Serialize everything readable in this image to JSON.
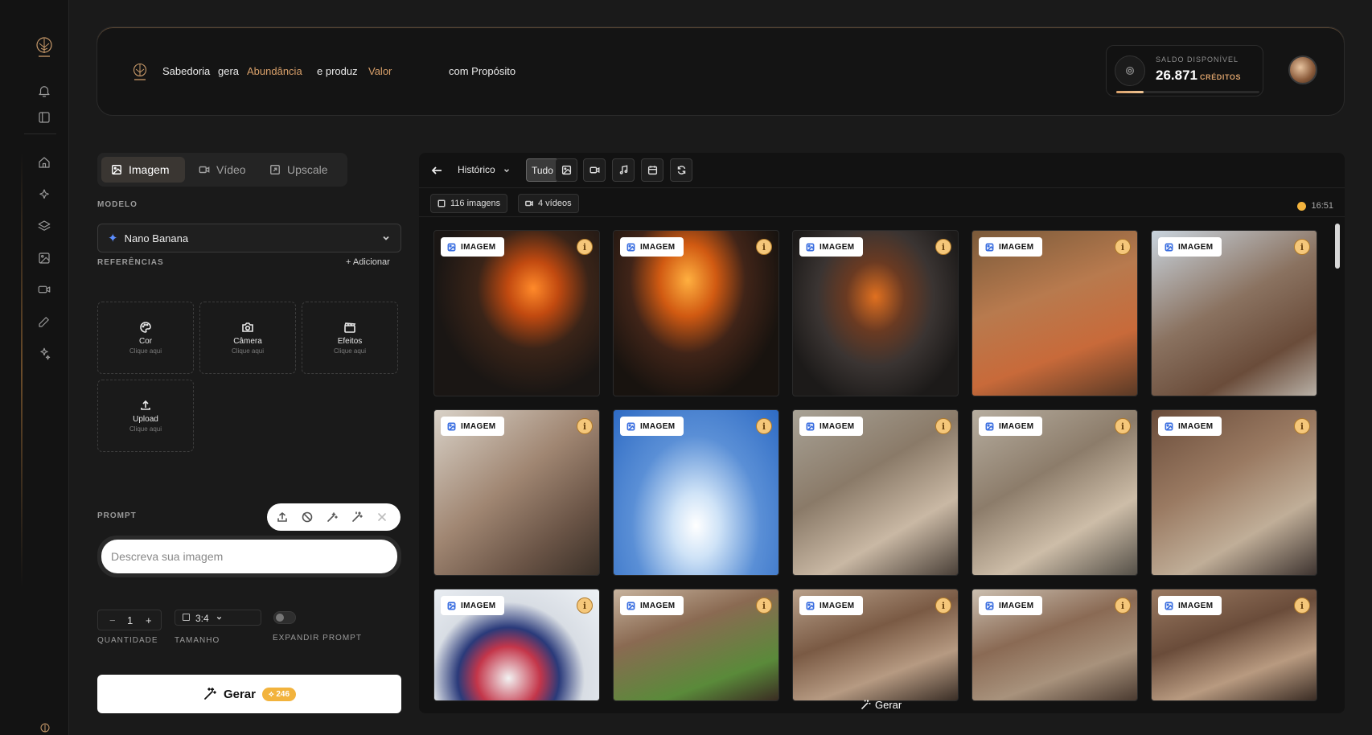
{
  "header": {
    "tagline": [
      {
        "text": "Sabedoria",
        "gold": false
      },
      {
        "text": "gera",
        "gold": false
      },
      {
        "text": "Abundância",
        "gold": true
      },
      {
        "text": "e produz",
        "gold": false
      },
      {
        "text": "Valor",
        "gold": true
      },
      {
        "text": "com Propósito",
        "gold": false
      }
    ],
    "credits": {
      "label": "SALDO DISPONÍVEL",
      "value": "26.871",
      "unit": "CRÉDITOS",
      "progress": 0.19
    }
  },
  "rail": {
    "icons": [
      "bell-icon",
      "sidebar-toggle-icon",
      "home-icon",
      "sparkles-icon",
      "layers-icon",
      "image-icon",
      "video-icon",
      "edit-icon",
      "magic-icon"
    ]
  },
  "left_panel": {
    "tabs": [
      {
        "label": "Imagem",
        "icon": "image-icon",
        "active": true
      },
      {
        "label": "Vídeo",
        "icon": "video-icon",
        "active": false
      },
      {
        "label": "Upscale",
        "icon": "upscale-icon",
        "active": false
      }
    ],
    "model_label": "MODELO",
    "model_value": "Nano Banana",
    "references_label": "REFERÊNCIAS",
    "add_label": "+ Adicionar",
    "ref_cards": [
      {
        "title": "Cor",
        "sub": "Clique aqui",
        "icon": "palette-icon"
      },
      {
        "title": "Câmera",
        "sub": "Clique aqui",
        "icon": "camera-icon"
      },
      {
        "title": "Efeitos",
        "sub": "Clique aqui",
        "icon": "clapper-icon"
      },
      {
        "title": "Upload",
        "sub": "Clique aqui",
        "icon": "upload-icon"
      }
    ],
    "prompt_label": "PROMPT",
    "prompt_placeholder": "Descreva sua imagem",
    "quantity": {
      "minus": "−",
      "value": "1",
      "plus": "+",
      "label": "QUANTIDADE"
    },
    "size": {
      "value": "3:4",
      "label": "TAMANHO"
    },
    "expand_label": "EXPANDIR PROMPT",
    "generate": {
      "label": "Gerar",
      "cost": "246"
    }
  },
  "gallery": {
    "history_label": "Histórico",
    "filters": [
      {
        "label": "Tudo",
        "icon": "",
        "active": true
      },
      {
        "label": "",
        "icon": "image-icon",
        "active": false
      },
      {
        "label": "",
        "icon": "video-icon",
        "active": false
      },
      {
        "label": "",
        "icon": "music-icon",
        "active": false
      },
      {
        "label": "",
        "icon": "calendar-icon",
        "active": false
      },
      {
        "label": "",
        "icon": "refresh-icon",
        "active": false
      }
    ],
    "stats": {
      "images": "116 imagens",
      "videos": "4 vídeos"
    },
    "time": "16:51",
    "badge_label": "IMAGEM",
    "info_glyph": "i",
    "footer_generate": "Gerar",
    "tiles": [
      {
        "scene": "bg-car"
      },
      {
        "scene": "bg-car2"
      },
      {
        "scene": "bg-car3"
      },
      {
        "scene": "bg-woman1"
      },
      {
        "scene": "bg-woman2"
      },
      {
        "scene": "bg-cook"
      },
      {
        "scene": "bg-sky"
      },
      {
        "scene": "bg-old1"
      },
      {
        "scene": "bg-old2"
      },
      {
        "scene": "bg-old3"
      },
      {
        "scene": "bg-ball"
      },
      {
        "scene": "bg-cream1"
      },
      {
        "scene": "bg-cream2"
      },
      {
        "scene": "bg-cream3"
      },
      {
        "scene": "bg-cream4"
      }
    ]
  }
}
